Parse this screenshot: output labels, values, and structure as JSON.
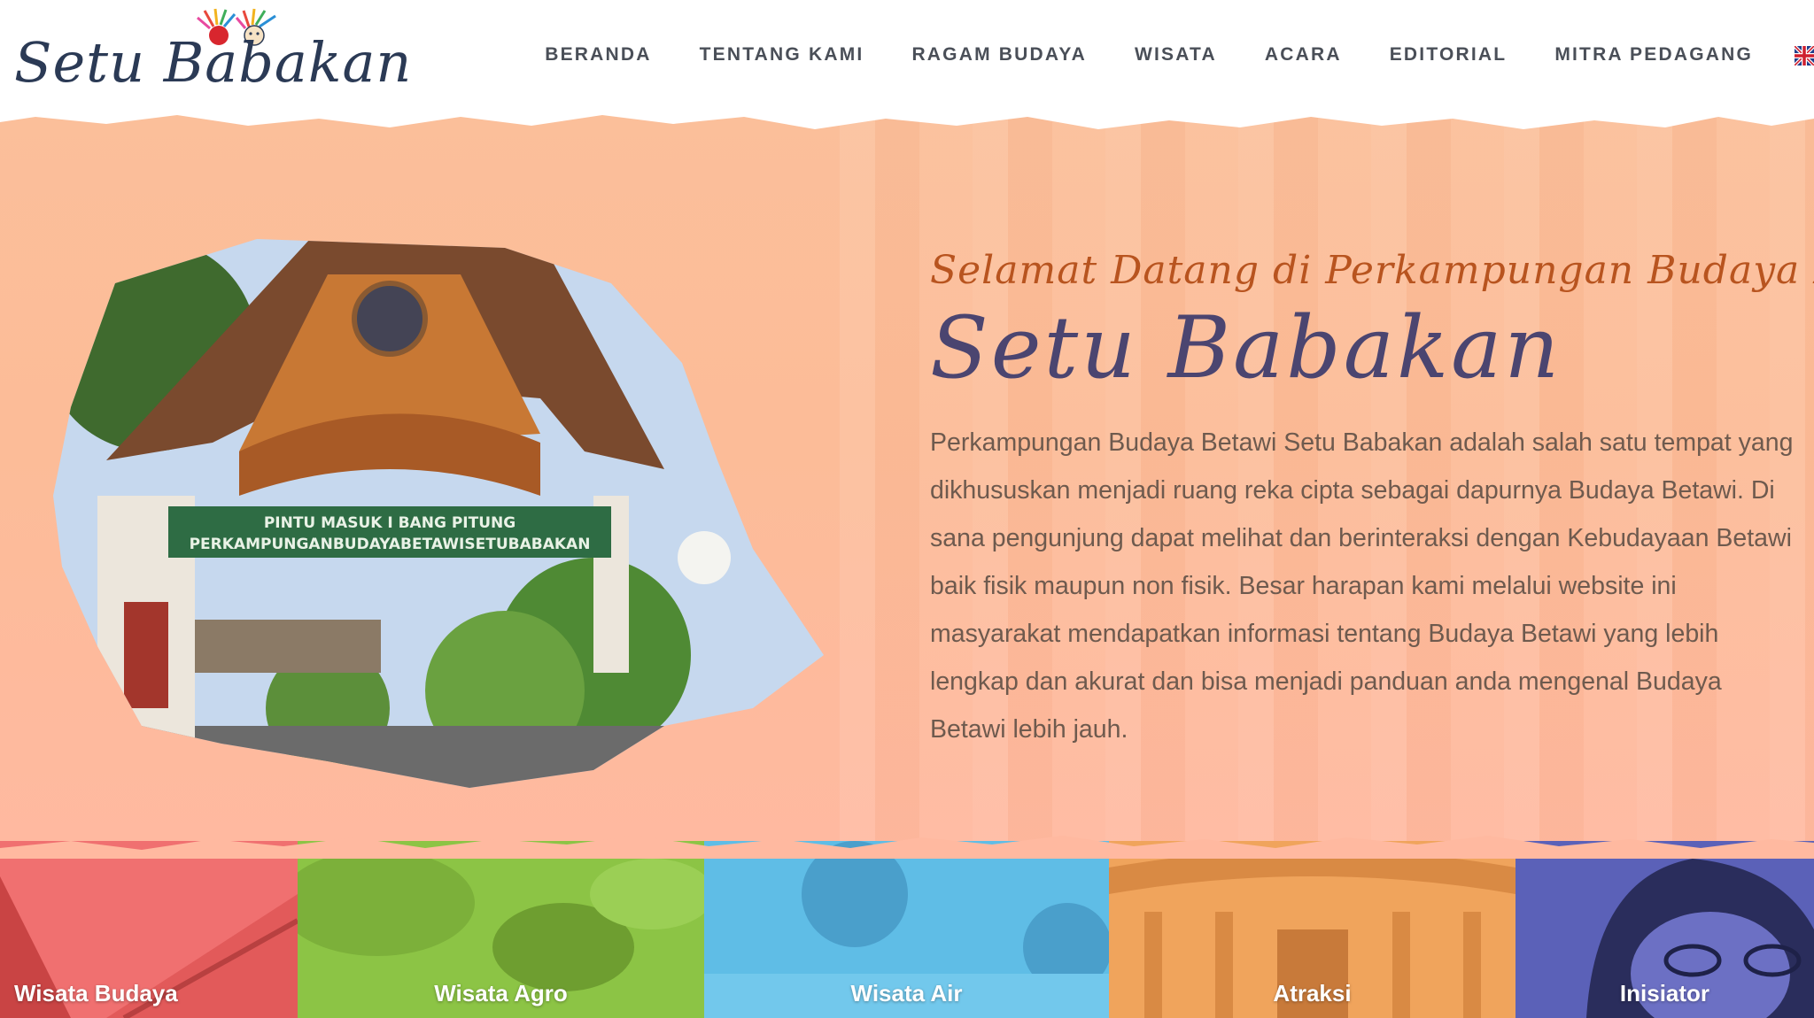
{
  "brand": {
    "logo_text": "Setu Babakan"
  },
  "nav": {
    "items": [
      {
        "label": "BERANDA"
      },
      {
        "label": "TENTANG KAMI"
      },
      {
        "label": "RAGAM BUDAYA"
      },
      {
        "label": "WISATA"
      },
      {
        "label": "ACARA"
      },
      {
        "label": "EDITORIAL"
      },
      {
        "label": "MITRA PEDAGANG"
      }
    ],
    "language_icon": "uk-flag-icon"
  },
  "hero": {
    "welcome": "Selamat Datang di Perkampungan Budaya Betawi",
    "title": "Setu Babakan",
    "description": "Perkampungan Budaya Betawi Setu Babakan adalah salah satu tempat yang dikhususkan menjadi ruang reka cipta sebagai dapurnya Budaya Betawi. Di sana pengunjung dapat melihat dan berinteraksi dengan Kebudayaan Betawi baik fisik maupun non fisik. Besar harapan kami melalui website ini masyarakat mendapatkan informasi tentang Budaya Betawi yang lebih lengkap dan akurat dan bisa menjadi panduan anda mengenal Budaya Betawi lebih jauh.",
    "gate_sign_line1": "PINTU MASUK I BANG PITUNG",
    "gate_sign_line2": "PERKAMPUNGANBUDAYABETAWISETUBABAKAN"
  },
  "tiles": [
    {
      "label": "Wisata Budaya",
      "color": "#f07070"
    },
    {
      "label": "Wisata Agro",
      "color": "#8cc445"
    },
    {
      "label": "Wisata Air",
      "color": "#5fbde6"
    },
    {
      "label": "Atraksi",
      "color": "#f0a45c"
    },
    {
      "label": "Inisiator",
      "color": "#5b61b8"
    }
  ],
  "colors": {
    "hero_bg": "#fcbc98",
    "welcome_text": "#b8541f",
    "title_text": "#4b4570",
    "body_text": "#6e5a4e",
    "nav_text": "#4a4f58"
  }
}
